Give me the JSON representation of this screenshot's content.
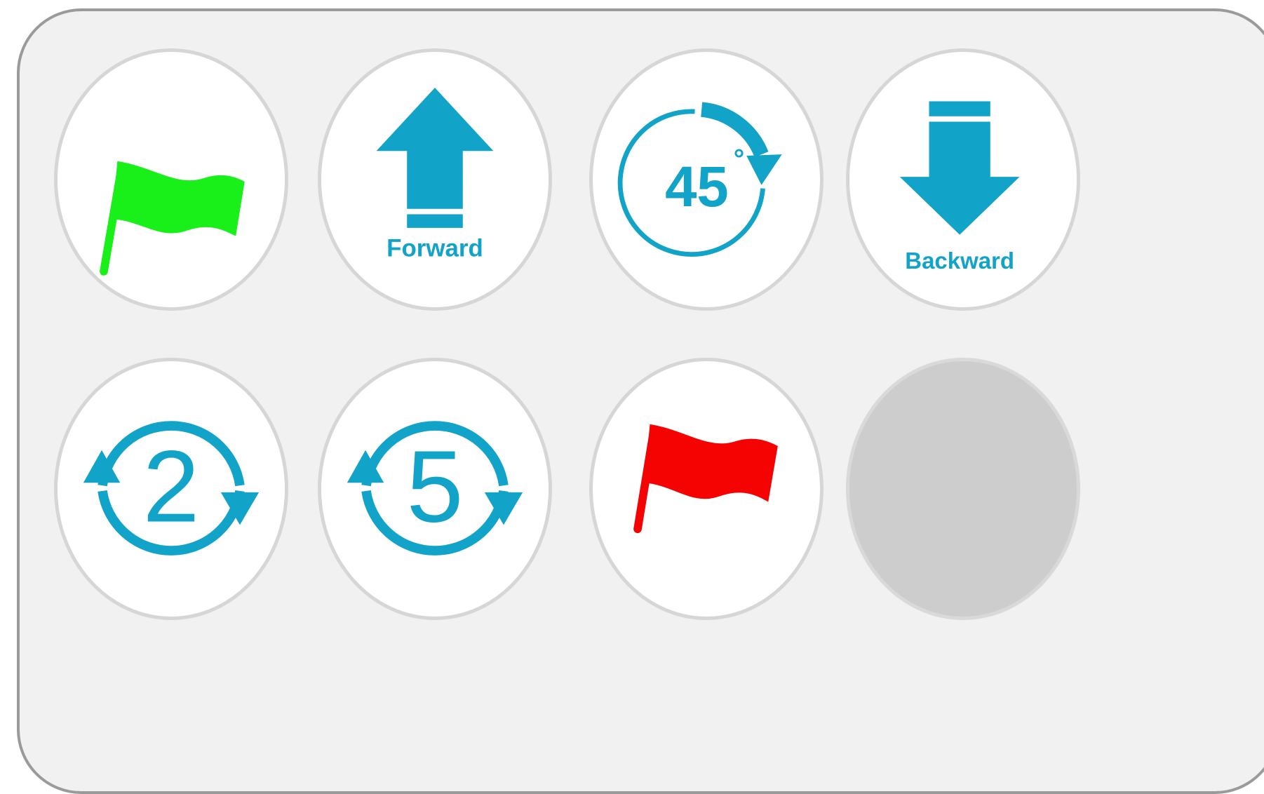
{
  "blocks": [
    {
      "name": "green-flag",
      "icon": "flag-icon",
      "color": "#19f019"
    },
    {
      "name": "forward",
      "icon": "arrow-up-icon",
      "label": "Forward",
      "color": "#12a3c9"
    },
    {
      "name": "turn-45",
      "icon": "rotate-clockwise-icon",
      "label": "45",
      "degree": "°",
      "color": "#12a3c9"
    },
    {
      "name": "backward",
      "icon": "arrow-down-icon",
      "label": "Backward",
      "color": "#12a3c9"
    },
    {
      "name": "repeat-2",
      "icon": "repeat-icon",
      "label": "2",
      "color": "#12a3c9"
    },
    {
      "name": "repeat-5",
      "icon": "repeat-icon",
      "label": "5",
      "color": "#12a3c9"
    },
    {
      "name": "red-flag",
      "icon": "flag-icon",
      "color": "#f50202"
    },
    {
      "name": "empty-slot",
      "icon": ""
    }
  ]
}
